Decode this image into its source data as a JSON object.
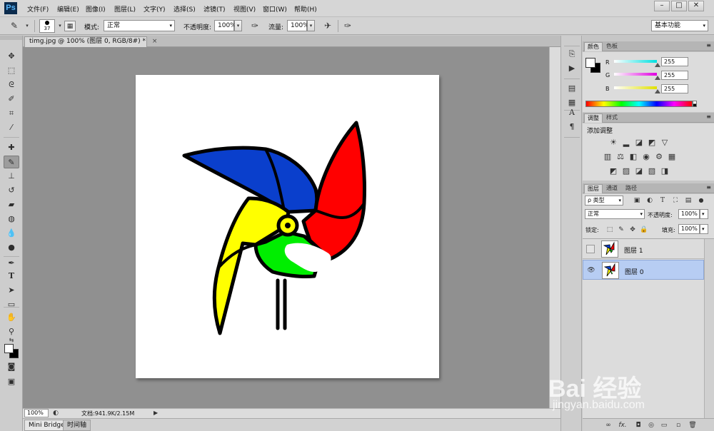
{
  "app": {
    "logo": "Ps",
    "menu": [
      "文件(F)",
      "编辑(E)",
      "图像(I)",
      "图层(L)",
      "文字(Y)",
      "选择(S)",
      "滤镜(T)",
      "视图(V)",
      "窗口(W)",
      "帮助(H)"
    ],
    "window_controls": {
      "minimize": "–",
      "maximize": "□",
      "close": "✕"
    }
  },
  "options_bar": {
    "brush_size": "37",
    "mode_label": "模式:",
    "mode_value": "正常",
    "opacity_label": "不透明度:",
    "opacity_value": "100%",
    "flow_label": "流量:",
    "flow_value": "100%",
    "workspace": "基本功能"
  },
  "document": {
    "tab_title": "timg.jpg @ 100% (图层 0, RGB/8#) *",
    "tab_close": "×",
    "zoom": "100%",
    "doc_info": "文档:941.9K/2.15M",
    "status_arrow": "▶"
  },
  "bottom_tabs": [
    "Mini Bridge",
    "时间轴"
  ],
  "color_panel": {
    "tabs": [
      "颜色",
      "色板"
    ],
    "channels": [
      {
        "label": "R",
        "value": "255",
        "color": "#00e0e0"
      },
      {
        "label": "G",
        "value": "255",
        "color": "#e000e0"
      },
      {
        "label": "B",
        "value": "255",
        "color": "#e0e000"
      }
    ],
    "foreground": "#ffffff",
    "background": "#000000"
  },
  "adjustments_panel": {
    "tabs": [
      "调整",
      "样式"
    ],
    "title": "添加调整"
  },
  "layers_panel": {
    "tabs": [
      "图层",
      "通道",
      "路径"
    ],
    "filter": "ρ 类型",
    "blend_mode": "正常",
    "opacity_label": "不透明度:",
    "opacity_value": "100%",
    "lock_label": "锁定:",
    "fill_label": "填充:",
    "fill_value": "100%",
    "layers": [
      {
        "name": "图层 1",
        "visible": false,
        "selected": false
      },
      {
        "name": "图层 0",
        "visible": true,
        "selected": true
      }
    ],
    "footer_icons": [
      "∞",
      "fx.",
      "◘",
      "◎",
      "▭",
      "▫",
      "🗑"
    ]
  },
  "artwork": {
    "colors": {
      "blue": "#0a3fcc",
      "red": "#ff0000",
      "yellow": "#ffff00",
      "green": "#00ee00",
      "outline": "#000000",
      "white": "#ffffff"
    }
  },
  "watermark": {
    "line1": "Bai 经验",
    "line2": "jingyan.baidu.com"
  }
}
